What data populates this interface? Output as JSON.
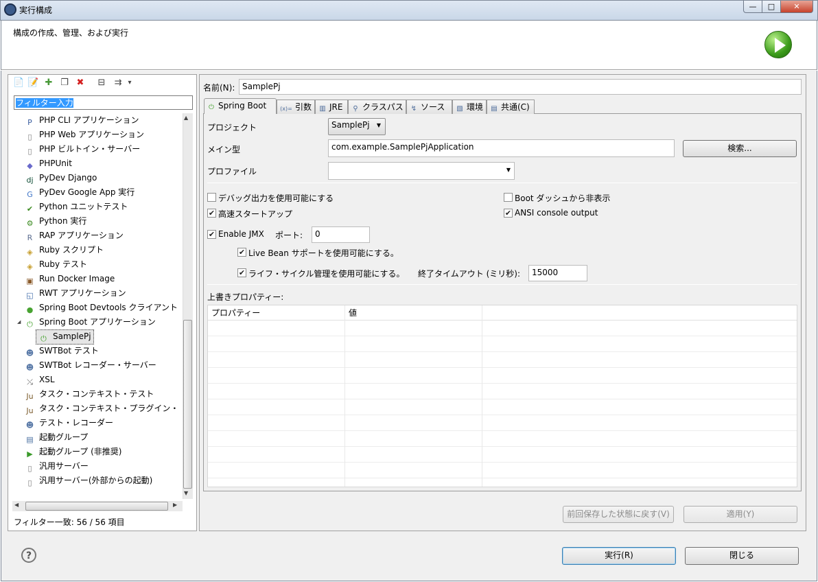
{
  "window": {
    "title": "実行構成",
    "min": "—",
    "max": "□",
    "close": "✕"
  },
  "header": {
    "description": "構成の作成、管理、および実行"
  },
  "left": {
    "toolbar": {
      "new": "📄",
      "new_proto": "📝",
      "export": "✚",
      "duplicate": "❐",
      "delete": "✖",
      "collapse": "⊟",
      "filter": "⇉",
      "menu": "▾"
    },
    "filter_input": "フィルター入力",
    "tree": [
      {
        "label": "PHP CLI アプリケーション",
        "icon": "P",
        "color": "#3a5d9f"
      },
      {
        "label": "PHP Web アプリケーション",
        "icon": "▯",
        "color": "#777"
      },
      {
        "label": "PHP ビルトイン・サーバー",
        "icon": "▯",
        "color": "#777"
      },
      {
        "label": "PHPUnit",
        "icon": "◆",
        "color": "#6a6acb"
      },
      {
        "label": "PyDev Django",
        "icon": "dj",
        "color": "#0c4b33"
      },
      {
        "label": "PyDev Google App 実行",
        "icon": "G",
        "color": "#3f74c7"
      },
      {
        "label": "Python ユニットテスト",
        "icon": "✔",
        "color": "#3a8a1f"
      },
      {
        "label": "Python 実行",
        "icon": "⚙",
        "color": "#3a8a1f"
      },
      {
        "label": "RAP アプリケーション",
        "icon": "R",
        "color": "#5b6c8f"
      },
      {
        "label": "Ruby スクリプト",
        "icon": "◈",
        "color": "#c8a030"
      },
      {
        "label": "Ruby テスト",
        "icon": "◈",
        "color": "#c8a030"
      },
      {
        "label": "Run Docker Image",
        "icon": "▣",
        "color": "#8a5a2a"
      },
      {
        "label": "RWT アプリケーション",
        "icon": "◱",
        "color": "#3d6aa8"
      },
      {
        "label": "Spring Boot Devtools クライアント",
        "icon": "●",
        "color": "#48a332"
      },
      {
        "label": "Spring Boot アプリケーション",
        "icon": "⏻",
        "color": "#48a332"
      },
      {
        "label": "SamplePj",
        "icon": "⏻",
        "color": "#48a332"
      },
      {
        "label": "SWTBot テスト",
        "icon": "☻",
        "color": "#5a7aa8"
      },
      {
        "label": "SWTBot レコーダー・サーバー",
        "icon": "☻",
        "color": "#5a7aa8"
      },
      {
        "label": "XSL",
        "icon": "⤯",
        "color": "#555"
      },
      {
        "label": "タスク・コンテキスト・テスト",
        "icon": "Ju",
        "color": "#7a5a2a"
      },
      {
        "label": "タスク・コンテキスト・プラグイン・",
        "icon": "Ju",
        "color": "#7a5a2a"
      },
      {
        "label": "テスト・レコーダー",
        "icon": "☻",
        "color": "#5a7aa8"
      },
      {
        "label": "起動グループ",
        "icon": "▤",
        "color": "#4a6fa0"
      },
      {
        "label": "起動グループ (非推奨)",
        "icon": "▶",
        "color": "#3a9a2a"
      },
      {
        "label": "汎用サーバー",
        "icon": "▯",
        "color": "#777"
      },
      {
        "label": "汎用サーバー(外部からの起動)",
        "icon": "▯",
        "color": "#777"
      }
    ],
    "filter_count": "フィルター一致: 56 / 56 項目"
  },
  "right": {
    "name_label": "名前(N):",
    "name_value": "SamplePj",
    "tabs": [
      {
        "label": "Spring Boot",
        "icon": "⏻"
      },
      {
        "label": "引数",
        "icon": "(x)="
      },
      {
        "label": "JRE",
        "icon": "▥"
      },
      {
        "label": "クラスパス",
        "icon": "⚲"
      },
      {
        "label": "ソース",
        "icon": "↯"
      },
      {
        "label": "環境",
        "icon": "▧"
      },
      {
        "label": "共通(C)",
        "icon": "▤"
      }
    ],
    "project_label": "プロジェクト",
    "project_value": "SamplePj",
    "main_type_label": "メイン型",
    "main_type_value": "com.example.SamplePjApplication",
    "search_button": "検索...",
    "profile_label": "プロファイル",
    "profile_value": "",
    "checkboxes": {
      "debug_output": {
        "label": "デバッグ出力を使用可能にする",
        "checked": false
      },
      "hide_dash": {
        "label": "Boot ダッシュから非表示",
        "checked": false
      },
      "fast_startup": {
        "label": "高速スタートアップ",
        "checked": true
      },
      "ansi": {
        "label": "ANSI console output",
        "checked": true
      },
      "jmx": {
        "label": "Enable JMX",
        "checked": true
      },
      "live_bean": {
        "label": "Live Bean サポートを使用可能にする。",
        "checked": true
      },
      "lifecycle": {
        "label": "ライフ・サイクル管理を使用可能にする。",
        "checked": true
      }
    },
    "port_label": "ポート:",
    "port_value": "0",
    "timeout_label": "終了タイムアウト (ミリ秒):",
    "timeout_value": "15000",
    "override_label": "上書きプロパティー:",
    "table_headers": [
      "プロパティー",
      "値",
      ""
    ],
    "revert_button": "前回保存した状態に戻す(V)",
    "apply_button": "適用(Y)"
  },
  "footer": {
    "help": "?",
    "run_button": "実行(R)",
    "close_button": "閉じる"
  }
}
